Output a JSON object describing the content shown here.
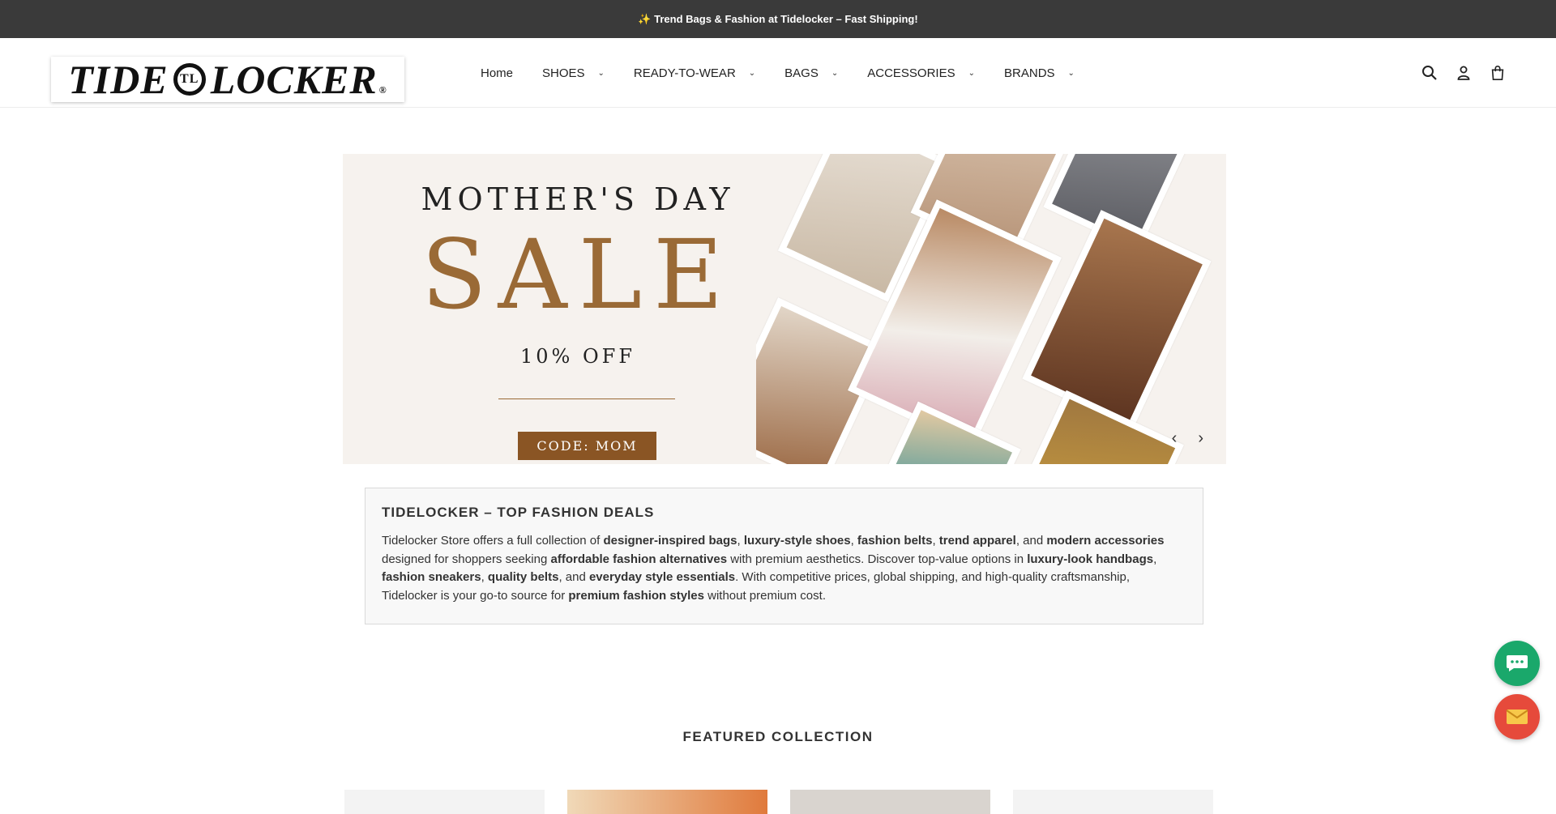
{
  "announcement": "✨ Trend Bags & Fashion at Tidelocker – Fast Shipping!",
  "logo": {
    "left": "TIDE",
    "mark": "TL",
    "right": "LOCKER",
    "reg": "®"
  },
  "nav": [
    {
      "label": "Home",
      "dropdown": false
    },
    {
      "label": "SHOES",
      "dropdown": true
    },
    {
      "label": "READY-TO-WEAR",
      "dropdown": true
    },
    {
      "label": "BAGS",
      "dropdown": true
    },
    {
      "label": "ACCESSORIES",
      "dropdown": true
    },
    {
      "label": "BRANDS",
      "dropdown": true
    }
  ],
  "header_icons": [
    "search-icon",
    "account-icon",
    "cart-icon"
  ],
  "hero": {
    "subtitle": "MOTHER'S DAY",
    "title": "SALE",
    "offer": "10% OFF",
    "code": "CODE: MOM",
    "prev": "‹",
    "next": "›"
  },
  "info": {
    "heading": "TIDELOCKER – TOP FASHION DEALS",
    "segments": [
      {
        "t": "Tidelocker Store offers a full collection of ",
        "b": false
      },
      {
        "t": "designer-inspired bags",
        "b": true
      },
      {
        "t": ", ",
        "b": false
      },
      {
        "t": "luxury-style shoes",
        "b": true
      },
      {
        "t": ", ",
        "b": false
      },
      {
        "t": "fashion belts",
        "b": true
      },
      {
        "t": ", ",
        "b": false
      },
      {
        "t": "trend apparel",
        "b": true
      },
      {
        "t": ", and ",
        "b": false
      },
      {
        "t": "modern accessories",
        "b": true
      },
      {
        "t": " designed for shoppers seeking ",
        "b": false
      },
      {
        "t": "affordable fashion alternatives",
        "b": true
      },
      {
        "t": " with premium aesthetics. Discover top-value options in ",
        "b": false
      },
      {
        "t": "luxury-look handbags",
        "b": true
      },
      {
        "t": ", ",
        "b": false
      },
      {
        "t": "fashion sneakers",
        "b": true
      },
      {
        "t": ", ",
        "b": false
      },
      {
        "t": "quality belts",
        "b": true
      },
      {
        "t": ", and ",
        "b": false
      },
      {
        "t": "everyday style essentials",
        "b": true
      },
      {
        "t": ". With competitive prices, global shipping, and high-quality craftsmanship, Tidelocker is your go-to source for ",
        "b": false
      },
      {
        "t": "premium fashion styles",
        "b": true
      },
      {
        "t": " without premium cost.",
        "b": false
      }
    ]
  },
  "featured_title": "FEATURED COLLECTION",
  "colors": {
    "announce_bg": "#3a3a3a",
    "accent": "#9a6a36",
    "chat": "#1aa86b",
    "mail": "#e64a3b"
  }
}
